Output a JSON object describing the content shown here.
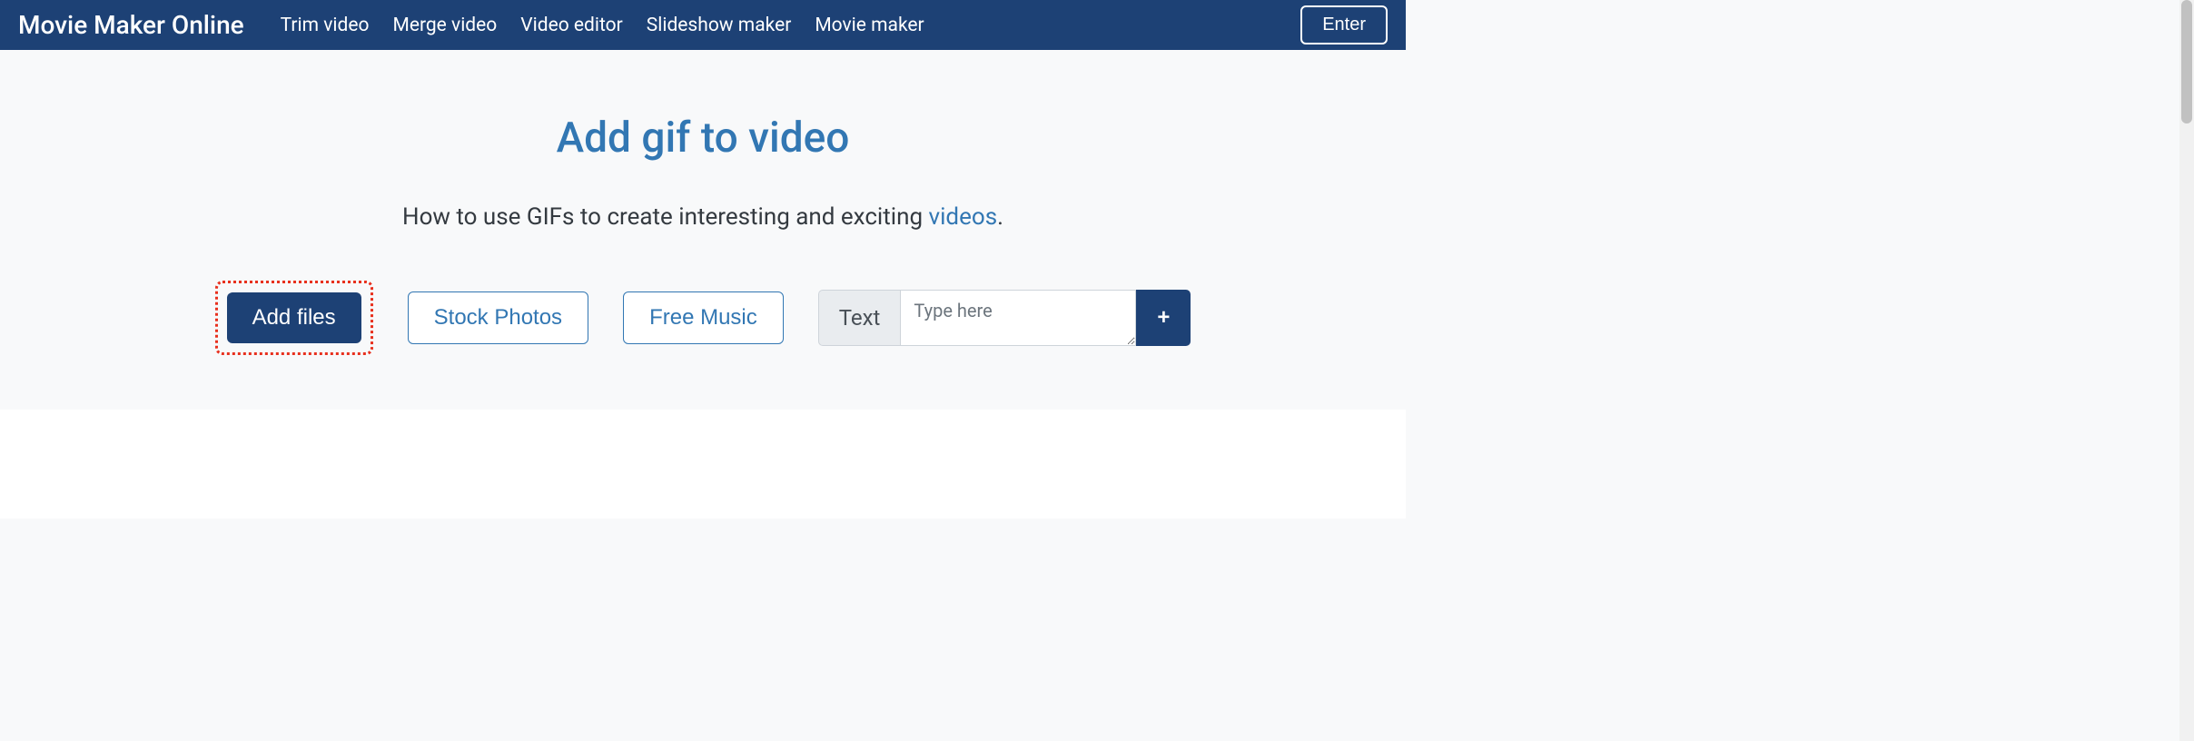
{
  "navbar": {
    "brand": "Movie Maker Online",
    "links": [
      "Trim video",
      "Merge video",
      "Video editor",
      "Slideshow maker",
      "Movie maker"
    ],
    "enter": "Enter"
  },
  "page": {
    "title": "Add gif to video",
    "subtitle_before": "How to use GIFs to create interesting and exciting ",
    "subtitle_link": "videos",
    "subtitle_after": "."
  },
  "actions": {
    "add_files": "Add files",
    "stock_photos": "Stock Photos",
    "free_music": "Free Music",
    "text_label": "Text",
    "text_placeholder": "Type here",
    "plus": "+"
  }
}
